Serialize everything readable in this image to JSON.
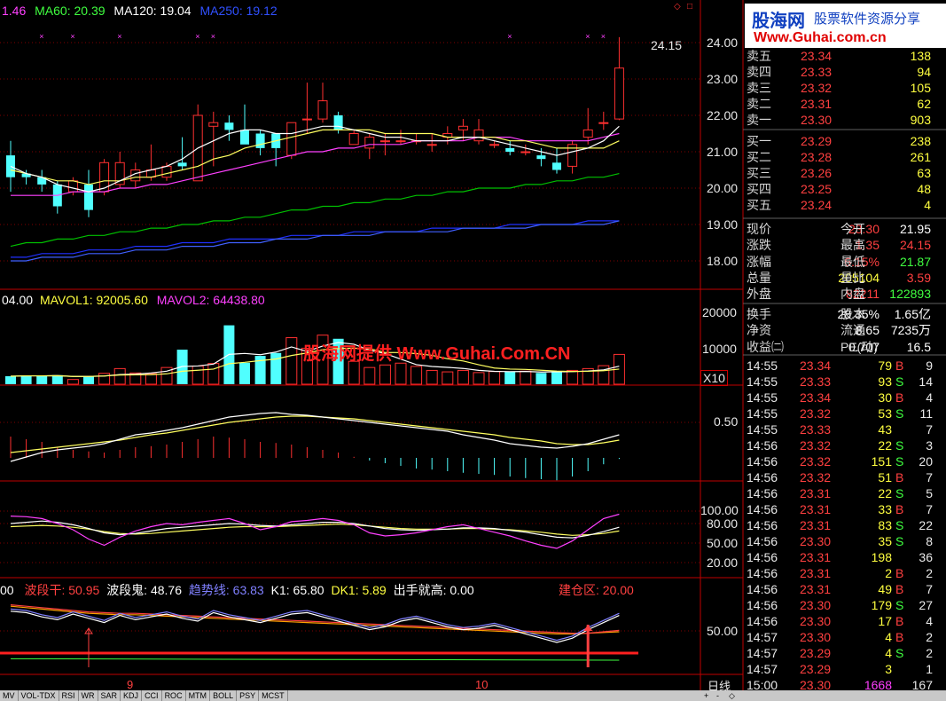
{
  "colors": {
    "up": "#ff3030",
    "down": "#50ffff",
    "grid": "#800000",
    "ma5": "#ffffff",
    "ma10": "#ffff00",
    "ma20": "#ff40ff",
    "ma60": "#00ff00",
    "ma120": "#4080ff",
    "ma250": "#2030ff"
  },
  "header": {
    "ma5_partial": "1.46",
    "ma60": "MA60: 20.39",
    "ma120": "MA120: 19.04",
    "ma250": "MA250: 19.12",
    "high_marker": "24.15"
  },
  "price_axis": [
    "24.00",
    "23.00",
    "22.00",
    "21.00",
    "20.00",
    "19.00",
    "18.00"
  ],
  "volume": {
    "vol_partial": "04.00",
    "mavol1": "MAVOL1: 92005.60",
    "mavol2": "MAVOL2: 64438.80",
    "axis": [
      "20000",
      "10000"
    ],
    "scale": "X10",
    "values": [
      2200,
      2400,
      2300,
      2500,
      1300,
      2200,
      3000,
      4300,
      3100,
      2900,
      4600,
      9500,
      5000,
      5700,
      16200,
      5900,
      7800,
      8600,
      12800,
      9900,
      13500,
      12500,
      6300,
      4600,
      5300,
      5800,
      4900,
      3800,
      3400,
      3800,
      3200,
      3500,
      3400,
      3600,
      3100,
      3400,
      3800,
      4300,
      5100,
      8200,
      20500
    ]
  },
  "watermark": "股海网提供 Www.Guhai.Com.CN",
  "macd": {
    "axis": [
      "0.50"
    ]
  },
  "kdj": {
    "axis": [
      "100.00",
      "80.00",
      "50.00",
      "20.00"
    ]
  },
  "indicator": {
    "prefix": "00",
    "wave_dry": "波段干: 50.95",
    "wave_ghost": "波段鬼: 48.76",
    "trend": "趋势线: 63.83",
    "k1": "K1: 65.80",
    "dk1": "DK1: 5.89",
    "new_high": "出手就高: 0.00",
    "build_zone": "建仓区: 20.00",
    "axis": [
      "50.00"
    ]
  },
  "date_axis": {
    "month9": "9",
    "month10": "10",
    "period": "日线"
  },
  "tabs": [
    "MV",
    "VOL-TDX",
    "RSI",
    "WR",
    "SAR",
    "KDJ",
    "CCI",
    "ROC",
    "MTM",
    "BOLL",
    "PSY",
    "MCST"
  ],
  "logo": {
    "brand": "股海网",
    "slogan": "股票软件资源分享",
    "url": "Www.Guhai.com.cn"
  },
  "order_book": {
    "sell": [
      {
        "label": "卖五",
        "price": "23.34",
        "vol": "138"
      },
      {
        "label": "卖四",
        "price": "23.33",
        "vol": "94"
      },
      {
        "label": "卖三",
        "price": "23.32",
        "vol": "105"
      },
      {
        "label": "卖二",
        "price": "23.31",
        "vol": "62"
      },
      {
        "label": "卖一",
        "price": "23.30",
        "vol": "903"
      }
    ],
    "buy": [
      {
        "label": "买一",
        "price": "23.29",
        "vol": "238"
      },
      {
        "label": "买二",
        "price": "23.28",
        "vol": "261"
      },
      {
        "label": "买三",
        "price": "23.26",
        "vol": "63"
      },
      {
        "label": "买四",
        "price": "23.25",
        "vol": "48"
      },
      {
        "label": "买五",
        "price": "23.24",
        "vol": "4"
      }
    ]
  },
  "quote": [
    {
      "l1": "现价",
      "v1": "23.30",
      "c1": "#ff4040",
      "l2": "今开",
      "v2": "21.95",
      "c2": "#ffffff"
    },
    {
      "l1": "涨跌",
      "v1": "1.35",
      "c1": "#ff4040",
      "l2": "最高",
      "v2": "24.15",
      "c2": "#ff4040"
    },
    {
      "l1": "涨幅",
      "v1": "6.15%",
      "c1": "#ff4040",
      "l2": "最低",
      "v2": "21.87",
      "c2": "#40ff40"
    },
    {
      "l1": "总量",
      "v1": "205104",
      "c1": "#ffff40",
      "l2": "量比",
      "v2": "3.59",
      "c2": "#ff4040"
    },
    {
      "l1": "外盘",
      "v1": "82211",
      "c1": "#ff4040",
      "l2": "内盘",
      "v2": "122893",
      "c2": "#40ff40"
    },
    {
      "l1": "换手",
      "v1": "28.35%",
      "c1": "#ffffff",
      "l2": "股本",
      "v2": "1.65亿",
      "c2": "#ffffff"
    },
    {
      "l1": "净资",
      "v1": "8.65",
      "c1": "#ffffff",
      "l2": "流通",
      "v2": "7235万",
      "c2": "#ffffff"
    },
    {
      "l1": "收益㈡",
      "v1": "0.707",
      "c1": "#ffffff",
      "l2": "PE(动)",
      "v2": "16.5",
      "c2": "#ffffff"
    }
  ],
  "ticks": [
    {
      "t": "14:55",
      "p": "23.34",
      "v": "79",
      "bs": "B",
      "n": "9"
    },
    {
      "t": "14:55",
      "p": "23.33",
      "v": "93",
      "bs": "S",
      "n": "14"
    },
    {
      "t": "14:55",
      "p": "23.34",
      "v": "30",
      "bs": "B",
      "n": "4"
    },
    {
      "t": "14:55",
      "p": "23.32",
      "v": "53",
      "bs": "S",
      "n": "11"
    },
    {
      "t": "14:55",
      "p": "23.33",
      "v": "43",
      "bs": "",
      "n": "7"
    },
    {
      "t": "14:56",
      "p": "23.32",
      "v": "22",
      "bs": "S",
      "n": "3"
    },
    {
      "t": "14:56",
      "p": "23.32",
      "v": "151",
      "bs": "S",
      "n": "20"
    },
    {
      "t": "14:56",
      "p": "23.32",
      "v": "51",
      "bs": "B",
      "n": "7"
    },
    {
      "t": "14:56",
      "p": "23.31",
      "v": "22",
      "bs": "S",
      "n": "5"
    },
    {
      "t": "14:56",
      "p": "23.31",
      "v": "33",
      "bs": "B",
      "n": "7"
    },
    {
      "t": "14:56",
      "p": "23.31",
      "v": "83",
      "bs": "S",
      "n": "22"
    },
    {
      "t": "14:56",
      "p": "23.30",
      "v": "35",
      "bs": "S",
      "n": "8"
    },
    {
      "t": "14:56",
      "p": "23.31",
      "v": "198",
      "bs": "",
      "n": "36"
    },
    {
      "t": "14:56",
      "p": "23.31",
      "v": "2",
      "bs": "B",
      "n": "2"
    },
    {
      "t": "14:56",
      "p": "23.31",
      "v": "49",
      "bs": "B",
      "n": "7"
    },
    {
      "t": "14:56",
      "p": "23.30",
      "v": "179",
      "bs": "S",
      "n": "27"
    },
    {
      "t": "14:56",
      "p": "23.30",
      "v": "17",
      "bs": "B",
      "n": "4"
    },
    {
      "t": "14:57",
      "p": "23.30",
      "v": "4",
      "bs": "B",
      "n": "2"
    },
    {
      "t": "14:57",
      "p": "23.29",
      "v": "4",
      "bs": "S",
      "n": "2"
    },
    {
      "t": "14:57",
      "p": "23.29",
      "v": "3",
      "bs": "",
      "n": "1"
    },
    {
      "t": "15:00",
      "p": "23.30",
      "v": "1668",
      "bs": "",
      "n": "167"
    }
  ],
  "chart_data": {
    "type": "candlestick",
    "ylim": [
      17.6,
      24.6
    ],
    "candles": [
      [
        20.9,
        21.3,
        19.9,
        20.3
      ],
      [
        20.4,
        20.5,
        20.1,
        20.3
      ],
      [
        20.3,
        20.5,
        19.9,
        20.1
      ],
      [
        20.1,
        20.2,
        19.3,
        19.5
      ],
      [
        19.9,
        20.3,
        19.8,
        20.2
      ],
      [
        20.1,
        20.5,
        19.2,
        19.4
      ],
      [
        19.9,
        20.8,
        19.8,
        20.7
      ],
      [
        20.1,
        21.0,
        20.0,
        20.7
      ],
      [
        20.2,
        20.7,
        20.0,
        20.5
      ],
      [
        20.3,
        21.2,
        20.2,
        20.5
      ],
      [
        20.3,
        20.7,
        20.2,
        20.6
      ],
      [
        20.7,
        21.4,
        20.5,
        20.6
      ],
      [
        20.2,
        22.3,
        20.2,
        22.0
      ],
      [
        21.7,
        22.1,
        20.6,
        21.8
      ],
      [
        21.8,
        22.0,
        21.3,
        21.6
      ],
      [
        21.6,
        22.3,
        21.6,
        21.2
      ],
      [
        21.5,
        21.6,
        20.9,
        21.1
      ],
      [
        21.5,
        21.5,
        20.6,
        21.1
      ],
      [
        20.9,
        21.8,
        20.8,
        21.8
      ],
      [
        21.9,
        22.9,
        21.5,
        21.9
      ],
      [
        21.9,
        22.9,
        21.8,
        22.4
      ],
      [
        22.0,
        22.1,
        21.5,
        21.6
      ],
      [
        21.2,
        21.6,
        21.3,
        21.5
      ],
      [
        21.1,
        21.5,
        20.8,
        21.4
      ],
      [
        21.3,
        21.5,
        20.9,
        21.3
      ],
      [
        21.3,
        21.6,
        21.2,
        21.3
      ],
      [
        21.3,
        21.5,
        21.2,
        21.3
      ],
      [
        21.2,
        21.5,
        21.0,
        21.2
      ],
      [
        21.4,
        21.7,
        21.2,
        21.5
      ],
      [
        21.6,
        21.9,
        21.3,
        21.7
      ],
      [
        21.3,
        21.9,
        21.2,
        21.6
      ],
      [
        21.2,
        21.3,
        21.1,
        21.2
      ],
      [
        21.1,
        21.3,
        20.9,
        21.0
      ],
      [
        21.0,
        21.2,
        20.9,
        21.0
      ],
      [
        20.9,
        21.1,
        20.6,
        20.8
      ],
      [
        20.7,
        21.1,
        20.4,
        20.5
      ],
      [
        20.6,
        21.3,
        20.4,
        21.2
      ],
      [
        21.4,
        22.2,
        21.2,
        21.6
      ],
      [
        21.8,
        22.1,
        21.6,
        21.8
      ],
      [
        21.9,
        24.15,
        21.87,
        23.3
      ]
    ],
    "ma5": [
      20.6,
      20.4,
      20.3,
      20.1,
      20.0,
      19.9,
      20.0,
      20.2,
      20.4,
      20.5,
      20.6,
      20.8,
      21.1,
      21.3,
      21.5,
      21.6,
      21.6,
      21.5,
      21.5,
      21.6,
      21.7,
      21.7,
      21.6,
      21.5,
      21.4,
      21.4,
      21.3,
      21.3,
      21.3,
      21.4,
      21.4,
      21.3,
      21.2,
      21.1,
      21.0,
      20.9,
      21.0,
      21.1,
      21.3,
      21.7
    ],
    "ma10": [
      20.5,
      20.4,
      20.3,
      20.2,
      20.2,
      20.1,
      20.2,
      20.2,
      20.3,
      20.3,
      20.4,
      20.5,
      20.6,
      20.8,
      20.9,
      21.1,
      21.2,
      21.3,
      21.4,
      21.5,
      21.6,
      21.6,
      21.6,
      21.6,
      21.5,
      21.5,
      21.5,
      21.5,
      21.4,
      21.4,
      21.4,
      21.4,
      21.3,
      21.3,
      21.2,
      21.1,
      21.1,
      21.1,
      21.1,
      21.3
    ],
    "ma20": [
      19.8,
      19.8,
      19.8,
      19.8,
      19.9,
      19.9,
      19.9,
      20.0,
      20.0,
      20.1,
      20.1,
      20.2,
      20.3,
      20.4,
      20.5,
      20.6,
      20.7,
      20.8,
      20.9,
      21.0,
      21.0,
      21.1,
      21.1,
      21.2,
      21.2,
      21.2,
      21.3,
      21.3,
      21.3,
      21.3,
      21.4,
      21.4,
      21.4,
      21.3,
      21.3,
      21.3,
      21.3,
      21.3,
      21.4,
      21.5
    ],
    "ma60": [
      18.4,
      18.5,
      18.5,
      18.6,
      18.6,
      18.7,
      18.7,
      18.8,
      18.8,
      18.9,
      18.9,
      19.0,
      19.0,
      19.1,
      19.1,
      19.2,
      19.2,
      19.3,
      19.4,
      19.4,
      19.5,
      19.5,
      19.6,
      19.6,
      19.7,
      19.7,
      19.8,
      19.8,
      19.9,
      19.9,
      20.0,
      20.0,
      20.0,
      20.1,
      20.1,
      20.2,
      20.2,
      20.3,
      20.3,
      20.4
    ],
    "ma120": [
      18.0,
      18.0,
      18.1,
      18.1,
      18.1,
      18.2,
      18.2,
      18.2,
      18.3,
      18.3,
      18.3,
      18.4,
      18.4,
      18.4,
      18.5,
      18.5,
      18.5,
      18.6,
      18.6,
      18.6,
      18.7,
      18.7,
      18.7,
      18.7,
      18.8,
      18.8,
      18.8,
      18.8,
      18.8,
      18.9,
      18.9,
      18.9,
      18.9,
      18.9,
      19.0,
      19.0,
      19.0,
      19.0,
      19.0,
      19.1
    ],
    "ma250": [
      18.1,
      18.1,
      18.2,
      18.2,
      18.2,
      18.3,
      18.3,
      18.3,
      18.4,
      18.4,
      18.4,
      18.5,
      18.5,
      18.5,
      18.6,
      18.6,
      18.6,
      18.6,
      18.7,
      18.7,
      18.7,
      18.7,
      18.8,
      18.8,
      18.8,
      18.8,
      18.8,
      18.9,
      18.9,
      18.9,
      18.9,
      18.9,
      19.0,
      19.0,
      19.0,
      19.0,
      19.0,
      19.1,
      19.1,
      19.1
    ]
  }
}
